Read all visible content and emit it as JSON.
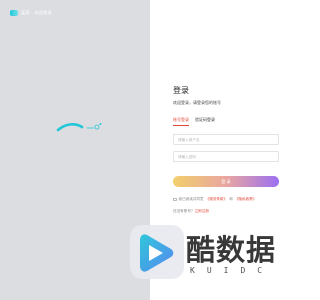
{
  "brand": {
    "name": "某局 · 欢迎登录",
    "logo_icon": "brand-mark-icon",
    "accent": "#22c6d8"
  },
  "illustration": {
    "icon": "wave-illustration-icon",
    "color": "#22c6d8"
  },
  "login": {
    "title": "登录",
    "subtitle": "欢迎登录，请登录您的账号",
    "tabs": [
      {
        "label": "账号登录",
        "active": true
      },
      {
        "label": "验证码登录",
        "active": false
      }
    ],
    "username_placeholder": "请输入用户名",
    "password_placeholder": "请输入密码",
    "submit_label": "登 录",
    "agree_prefix": "我已阅读并同意",
    "agree_link1": "《服务条款》",
    "agree_and": "和",
    "agree_link2": "《隐私政策》",
    "register_prefix": "还没有账号？",
    "register_link": "立即注册",
    "accent_color": "#e04a3a",
    "button_gradient": [
      "#f2cf6b",
      "#e9a6a0",
      "#9b6ff2"
    ]
  },
  "watermark": {
    "title": "酷数据",
    "subtitle": "KUIDC",
    "logo_icon": "play-logo-icon",
    "colors": [
      "#22c6d8",
      "#4a7ef0"
    ]
  }
}
